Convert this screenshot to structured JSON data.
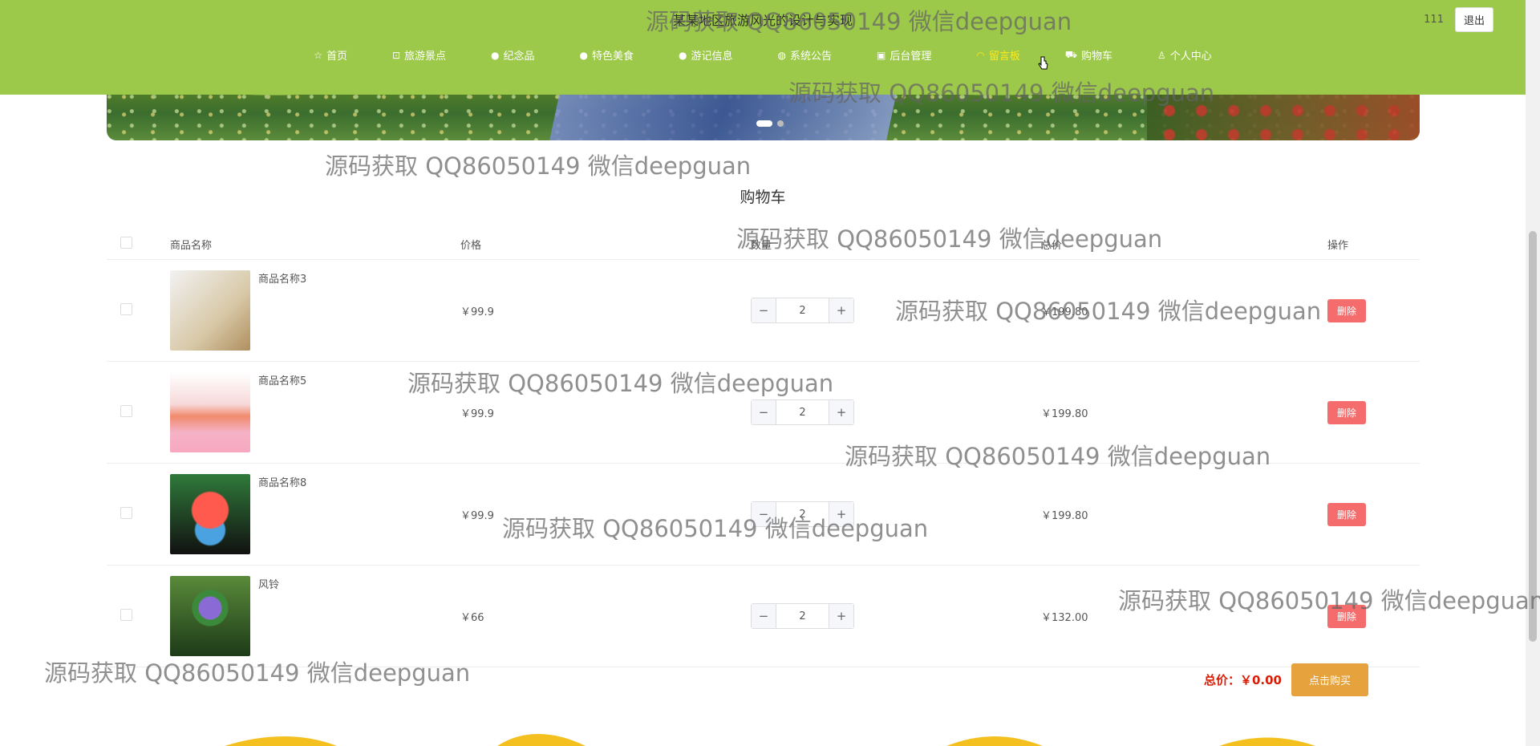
{
  "header": {
    "site_title": "某某地区旅游风光的设计与实现",
    "username": "111",
    "logout_label": "退出",
    "accent_color": "#9dc94a",
    "active_color": "#ffe81a"
  },
  "nav": [
    {
      "label": "首页",
      "icon": "star-icon"
    },
    {
      "label": "旅游景点",
      "icon": "bag-icon"
    },
    {
      "label": "纪念品",
      "icon": "info-icon"
    },
    {
      "label": "特色美食",
      "icon": "help-icon"
    },
    {
      "label": "游记信息",
      "icon": "info-icon"
    },
    {
      "label": "系统公告",
      "icon": "globe-icon"
    },
    {
      "label": "后台管理",
      "icon": "building-icon"
    },
    {
      "label": "留言板",
      "icon": "headset-icon",
      "active": true
    },
    {
      "label": "购物车",
      "icon": "cart-icon"
    },
    {
      "label": "个人中心",
      "icon": "user-icon"
    }
  ],
  "page_title": "购物车",
  "table": {
    "headers": {
      "name": "商品名称",
      "price": "价格",
      "quantity": "数量",
      "total": "总价",
      "action": "操作"
    },
    "rows": [
      {
        "name": "商品名称3",
        "price": "￥99.9",
        "quantity": "2",
        "total": "￥199.80",
        "delete_label": "删除"
      },
      {
        "name": "商品名称5",
        "price": "￥99.9",
        "quantity": "2",
        "total": "￥199.80",
        "delete_label": "删除"
      },
      {
        "name": "商品名称8",
        "price": "￥99.9",
        "quantity": "2",
        "total": "￥199.80",
        "delete_label": "删除"
      },
      {
        "name": "风铃",
        "price": "￥66",
        "quantity": "2",
        "total": "￥132.00",
        "delete_label": "删除"
      }
    ]
  },
  "summary": {
    "total_label": "总价：￥0.00",
    "buy_label": "点击购买"
  },
  "watermark": "源码获取 QQ86050149 微信deepguan"
}
